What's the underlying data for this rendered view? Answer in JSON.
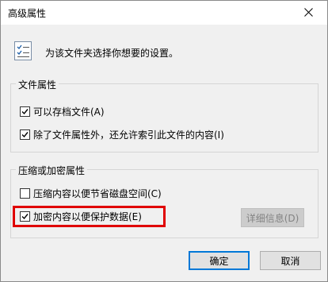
{
  "window": {
    "title": "高级属性",
    "close_icon": "close-icon"
  },
  "header": {
    "icon": "file-attributes-icon",
    "text": "为该文件夹选择你想要的设置。"
  },
  "file_attributes": {
    "title": "文件属性",
    "options": [
      {
        "label": "可以存档文件(A)",
        "checked": true
      },
      {
        "label": "除了文件属性外，还允许索引此文件的内容(I)",
        "checked": true
      }
    ]
  },
  "compress_encrypt": {
    "title": "压缩或加密属性",
    "options": [
      {
        "label": "压缩内容以便节省磁盘空间(C)",
        "checked": false
      },
      {
        "label": "加密内容以便保护数据(E)",
        "checked": true
      }
    ],
    "details_button": "详细信息(D)"
  },
  "footer": {
    "ok_label": "确定",
    "cancel_label": "取消"
  },
  "colors": {
    "highlight": "#e00000",
    "accent": "#0078d7"
  }
}
